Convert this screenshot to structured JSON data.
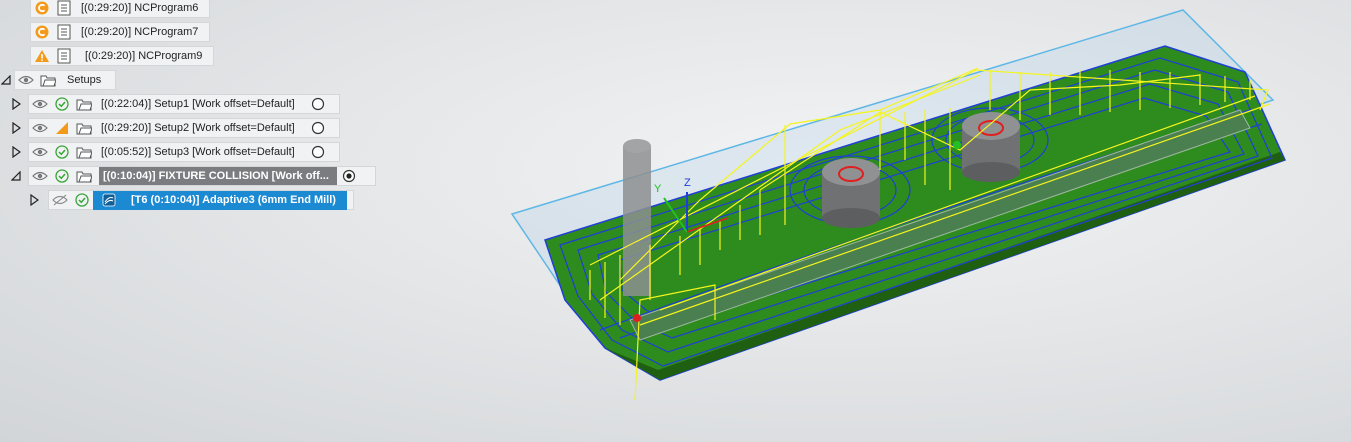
{
  "nc_programs": [
    {
      "time_label": "[(0:29:20)] NCProgram6",
      "status": "orange-c-icon"
    },
    {
      "time_label": "[(0:29:20)] NCProgram7",
      "status": "orange-c-icon"
    },
    {
      "time_label": "[(0:29:20)] NCProgram9",
      "status": "warning-icon"
    }
  ],
  "setups_folder": {
    "label": "Setups"
  },
  "setups": [
    {
      "label": "[(0:22:04)] Setup1 [Work offset=Default]",
      "status": "check-icon"
    },
    {
      "label": "[(0:29:20)] Setup2 [Work offset=Default]",
      "status": "warning-triangle-icon"
    },
    {
      "label": "[(0:05:52)] Setup3 [Work offset=Default]",
      "status": "check-icon"
    }
  ],
  "active_setup": {
    "label": "[(0:10:04)] FIXTURE COLLISION [Work off..."
  },
  "selected_operation": {
    "label": "[T6 (0:10:04)] Adaptive3 (6mm End Mill)"
  },
  "axes": {
    "y": "Y",
    "z": "Z"
  },
  "colors": {
    "accent": "#1c8ad3",
    "stock_green": "#2e8b1e",
    "toolpath_yellow": "#f5f51e",
    "toolpath_blue": "#1f3fd6",
    "warning": "#f39a1a"
  }
}
